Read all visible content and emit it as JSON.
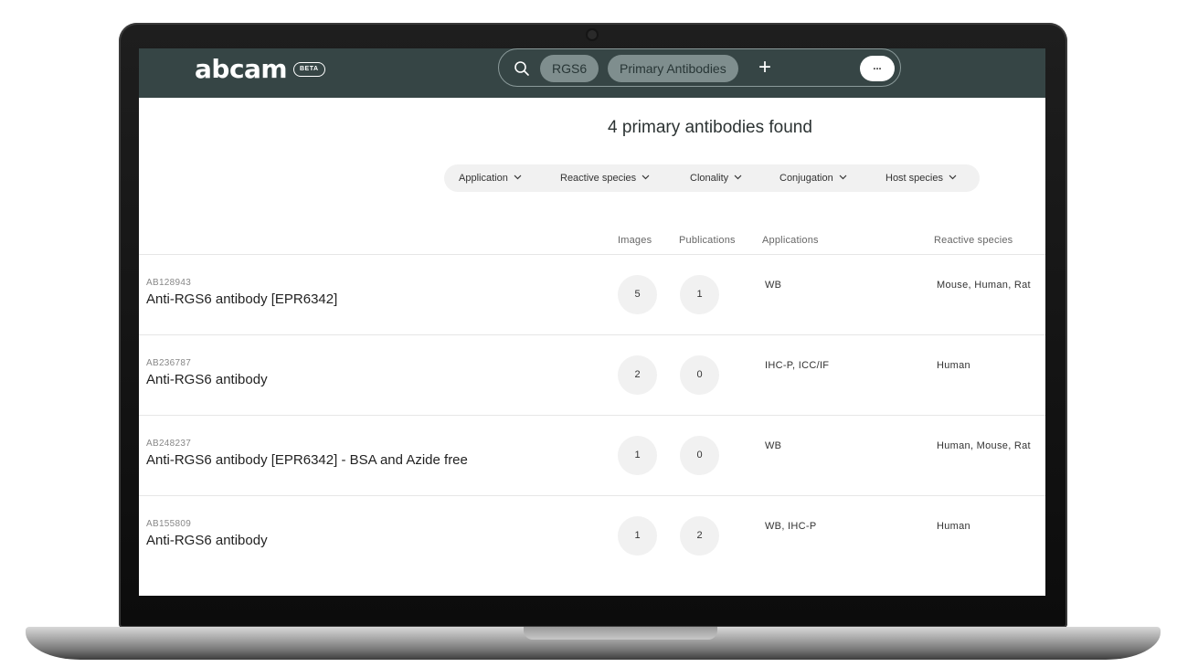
{
  "header": {
    "logo": "abcam",
    "beta_label": "BETA",
    "search_chips": [
      "RGS6",
      "Primary Antibodies"
    ],
    "add_label": "+",
    "more_label": "..."
  },
  "results": {
    "title": "4 primary antibodies found"
  },
  "filters": [
    {
      "label": "Application"
    },
    {
      "label": "Reactive species"
    },
    {
      "label": "Clonality"
    },
    {
      "label": "Conjugation"
    },
    {
      "label": "Host species"
    }
  ],
  "table": {
    "columns": {
      "images": "Images",
      "publications": "Publications",
      "applications": "Applications",
      "reactive_species": "Reactive species"
    },
    "rows": [
      {
        "id": "AB128943",
        "name": "Anti-RGS6 antibody [EPR6342]",
        "images": "5",
        "publications": "1",
        "applications": "WB",
        "species": "Mouse, Human, Rat"
      },
      {
        "id": "AB236787",
        "name": "Anti-RGS6 antibody",
        "images": "2",
        "publications": "0",
        "applications": "IHC-P, ICC/IF",
        "species": "Human"
      },
      {
        "id": "AB248237",
        "name": "Anti-RGS6 antibody [EPR6342] - BSA and Azide free",
        "images": "1",
        "publications": "0",
        "applications": "WB",
        "species": "Human, Mouse, Rat"
      },
      {
        "id": "AB155809",
        "name": "Anti-RGS6 antibody",
        "images": "1",
        "publications": "2",
        "applications": "WB, IHC-P",
        "species": "Human"
      }
    ]
  },
  "colors": {
    "header_bg": "#364545",
    "chip_bg": "#7f8e8e",
    "filter_bg": "#f1f1f1",
    "count_bg": "#f1f1f1"
  },
  "icons": {
    "search": "search-icon",
    "chevron": "chevron-down-icon"
  }
}
